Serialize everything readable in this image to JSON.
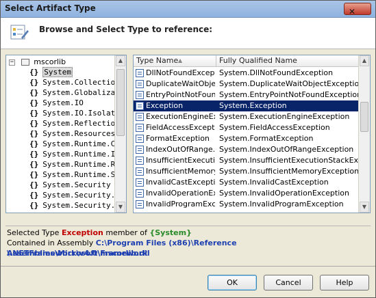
{
  "window": {
    "title": "Select Artifact Type"
  },
  "header": {
    "prompt": "Browse and Select Type to reference:"
  },
  "tree": {
    "root": "mscorlib",
    "items": [
      "System",
      "System.Collections.Gen",
      "System.Globalization",
      "System.IO",
      "System.IO.IsolatedStor",
      "System.Reflection",
      "System.Resources",
      "System.Runtime.Compil",
      "System.Runtime.Intero",
      "System.Runtime.Remot",
      "System.Runtime.Serializ",
      "System.Security",
      "System.Security.Access",
      "System.Security.Crypto"
    ],
    "selected_index": 0
  },
  "grid": {
    "columns": [
      "Type Name",
      "Fully Qualified Name"
    ],
    "rows": [
      [
        "DllNotFoundException",
        "System.DllNotFoundException"
      ],
      [
        "DuplicateWaitObje...",
        "System.DuplicateWaitObjectException"
      ],
      [
        "EntryPointNotFoun...",
        "System.EntryPointNotFoundException"
      ],
      [
        "Exception",
        "System.Exception"
      ],
      [
        "ExecutionEngineEx...",
        "System.ExecutionEngineException"
      ],
      [
        "FieldAccessException",
        "System.FieldAccessException"
      ],
      [
        "FormatException",
        "System.FormatException"
      ],
      [
        "IndexOutOfRange...",
        "System.IndexOutOfRangeException"
      ],
      [
        "InsufficientExecuti...",
        "System.InsufficientExecutionStackException"
      ],
      [
        "InsufficientMemory...",
        "System.InsufficientMemoryException"
      ],
      [
        "InvalidCastException",
        "System.InvalidCastException"
      ],
      [
        "InvalidOperationEx...",
        "System.InvalidOperationException"
      ],
      [
        "InvalidProgramExc...",
        "System.InvalidProgramException"
      ]
    ],
    "selected_index": 3
  },
  "info": {
    "selected_prefix": "Selected Type ",
    "selected_type": "Exception",
    "member_of": " member of ",
    "namespace": "{System}",
    "assembly_prefix": "Contained in Assembly ",
    "assembly_path_1": "C:\\Program Files (x86)\\Reference Assemblies\\Microsoft\\Framework",
    "assembly_path_2": "\\.NETFramework\\v4.0\\mscorlib.dll"
  },
  "buttons": {
    "ok": "OK",
    "cancel": "Cancel",
    "help": "Help"
  },
  "icons": {
    "close": "close-icon",
    "header": "artifact-type-icon",
    "type": "class-type-icon",
    "namespace": "namespace-icon"
  }
}
